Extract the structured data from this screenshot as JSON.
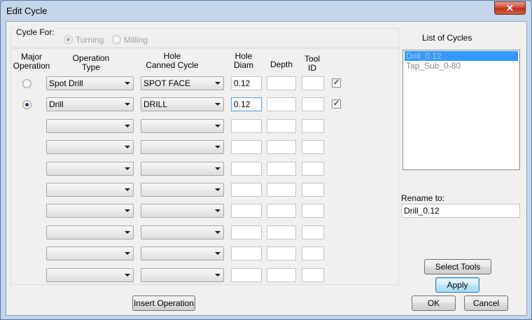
{
  "window": {
    "title": "Edit Cycle",
    "close_glyph": "✕"
  },
  "cycle_for": {
    "label": "Cycle For:",
    "options": [
      {
        "label": "Turning",
        "selected": true
      },
      {
        "label": "Milling",
        "selected": false
      }
    ]
  },
  "headers": {
    "major": [
      "Major",
      "Operation"
    ],
    "op_type": [
      "Operation",
      "Type"
    ],
    "canned": [
      "Hole",
      "Canned Cycle"
    ],
    "diam": [
      "Hole",
      "Diam"
    ],
    "depth": "Depth",
    "tool": [
      "Tool",
      "ID"
    ]
  },
  "rows": [
    {
      "major": "off",
      "op_type": "Spot Drill",
      "canned": "SPOT FACE",
      "diam": "0.12",
      "depth": "",
      "tool": "",
      "checked": true
    },
    {
      "major": "on",
      "op_type": "Drill",
      "canned": "DRILL",
      "diam": "0.12",
      "depth": "",
      "tool": "",
      "checked": true
    },
    {
      "major": "",
      "op_type": "",
      "canned": "",
      "diam": "",
      "depth": "",
      "tool": ""
    },
    {
      "major": "",
      "op_type": "",
      "canned": "",
      "diam": "",
      "depth": "",
      "tool": ""
    },
    {
      "major": "",
      "op_type": "",
      "canned": "",
      "diam": "",
      "depth": "",
      "tool": ""
    },
    {
      "major": "",
      "op_type": "",
      "canned": "",
      "diam": "",
      "depth": "",
      "tool": ""
    },
    {
      "major": "",
      "op_type": "",
      "canned": "",
      "diam": "",
      "depth": "",
      "tool": ""
    },
    {
      "major": "",
      "op_type": "",
      "canned": "",
      "diam": "",
      "depth": "",
      "tool": ""
    },
    {
      "major": "",
      "op_type": "",
      "canned": "",
      "diam": "",
      "depth": "",
      "tool": ""
    },
    {
      "major": "",
      "op_type": "",
      "canned": "",
      "diam": "",
      "depth": "",
      "tool": ""
    }
  ],
  "cycles": {
    "title": "List of Cycles",
    "items": [
      "Drill_0.12",
      "Tap_Sub_0-80"
    ],
    "selected_index": 0
  },
  "rename": {
    "label": "Rename to:",
    "value": "Drill_0.12"
  },
  "buttons": {
    "insert_operation": "Insert Operation",
    "select_tools": "Select Tools",
    "apply": "Apply",
    "ok": "OK",
    "cancel": "Cancel"
  },
  "check_glyph": "✓",
  "colors": {
    "selection": "#3399ff",
    "focus_border": "#5a9ad6",
    "close": "#c8452f"
  }
}
